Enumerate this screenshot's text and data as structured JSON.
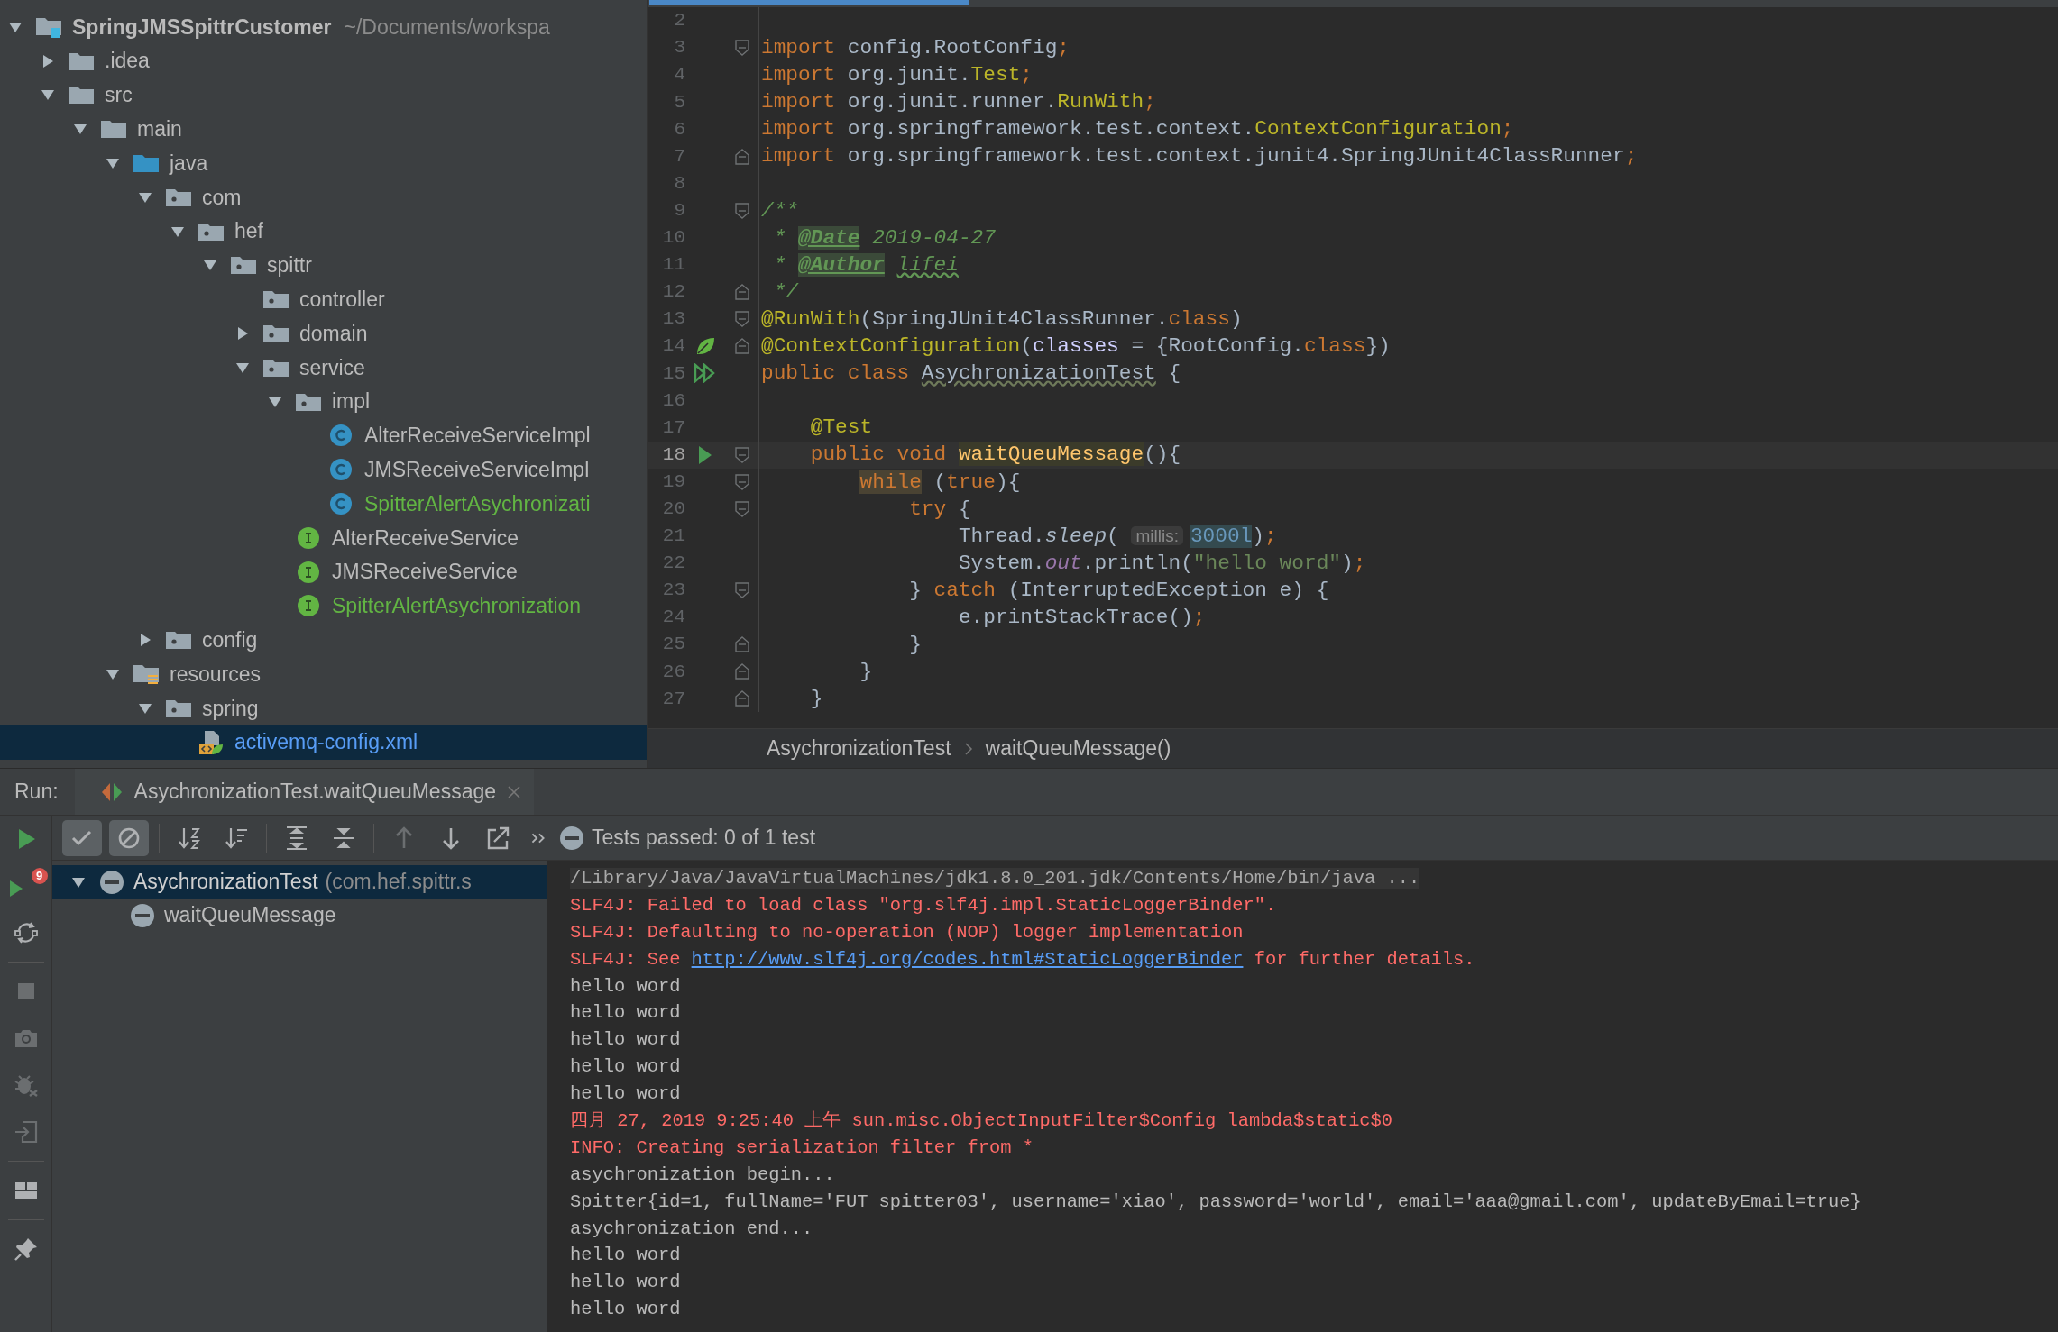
{
  "project_tree": [
    {
      "label": "SpringJMSSpittrCustomer",
      "path": "~/Documents/workspa",
      "kind": "module",
      "expanded": true,
      "selected": false,
      "color": "#bbbbbb",
      "children": [
        {
          "label": ".idea",
          "kind": "folder",
          "expanded": false,
          "selected": false,
          "color": "#bbbbbb"
        },
        {
          "label": "src",
          "kind": "folder",
          "expanded": true,
          "selected": false,
          "color": "#bbbbbb",
          "children": [
            {
              "label": "main",
              "kind": "folder",
              "expanded": true,
              "selected": false,
              "color": "#bbbbbb",
              "children": [
                {
                  "label": "java",
                  "kind": "source-folder",
                  "expanded": true,
                  "selected": false,
                  "color": "#bbbbbb",
                  "children": [
                    {
                      "label": "com",
                      "kind": "package",
                      "expanded": true,
                      "selected": false,
                      "color": "#bbbbbb",
                      "children": [
                        {
                          "label": "hef",
                          "kind": "package",
                          "expanded": true,
                          "selected": false,
                          "color": "#bbbbbb",
                          "children": [
                            {
                              "label": "spittr",
                              "kind": "package",
                              "expanded": true,
                              "selected": false,
                              "color": "#bbbbbb",
                              "children": [
                                {
                                  "label": "controller",
                                  "kind": "package",
                                  "selected": false,
                                  "color": "#bbbbbb"
                                },
                                {
                                  "label": "domain",
                                  "kind": "package",
                                  "expanded": false,
                                  "selected": false,
                                  "color": "#bbbbbb"
                                },
                                {
                                  "label": "service",
                                  "kind": "package",
                                  "expanded": true,
                                  "selected": false,
                                  "color": "#bbbbbb",
                                  "children": [
                                    {
                                      "label": "impl",
                                      "kind": "package",
                                      "expanded": true,
                                      "selected": false,
                                      "color": "#bbbbbb",
                                      "children": [
                                        {
                                          "label": "AlterReceiveServiceImpl",
                                          "kind": "class",
                                          "selected": false,
                                          "color": "#bbbbbb"
                                        },
                                        {
                                          "label": "JMSReceiveServiceImpl",
                                          "kind": "class",
                                          "selected": false,
                                          "color": "#bbbbbb"
                                        },
                                        {
                                          "label": "SpitterAlertAsychronizati",
                                          "kind": "class",
                                          "selected": false,
                                          "color": "#62b543"
                                        }
                                      ]
                                    },
                                    {
                                      "label": "AlterReceiveService",
                                      "kind": "interface",
                                      "selected": false,
                                      "color": "#bbbbbb"
                                    },
                                    {
                                      "label": "JMSReceiveService",
                                      "kind": "interface",
                                      "selected": false,
                                      "color": "#bbbbbb"
                                    },
                                    {
                                      "label": "SpitterAlertAsychronization",
                                      "kind": "interface",
                                      "selected": false,
                                      "color": "#62b543"
                                    }
                                  ]
                                }
                              ]
                            }
                          ]
                        }
                      ]
                    },
                    {
                      "label": "config",
                      "kind": "package",
                      "expanded": false,
                      "selected": false,
                      "color": "#bbbbbb"
                    }
                  ]
                },
                {
                  "label": "resources",
                  "kind": "resource-folder",
                  "expanded": true,
                  "selected": false,
                  "color": "#bbbbbb",
                  "children": [
                    {
                      "label": "spring",
                      "kind": "package",
                      "expanded": true,
                      "selected": false,
                      "color": "#bbbbbb",
                      "children": [
                        {
                          "label": "activemq-config.xml",
                          "kind": "xml",
                          "selected": true,
                          "color": "#589df6"
                        }
                      ]
                    }
                  ]
                }
              ]
            }
          ]
        }
      ]
    }
  ],
  "editor": {
    "lines": [
      {
        "number": "2",
        "kind": "code",
        "current": false
      },
      {
        "number": "3",
        "kind": "code",
        "current": false,
        "fold_start": true,
        "fold_end": false,
        "tokens": [
          {
            "text": "import",
            "kind": "keyword"
          },
          {
            "text": " config.RootConfig",
            "kind": "plain"
          },
          {
            "text": ";",
            "kind": "keyword"
          }
        ]
      },
      {
        "number": "4",
        "kind": "code",
        "current": false,
        "tokens": [
          {
            "text": "import",
            "kind": "keyword"
          },
          {
            "text": " org.junit.",
            "kind": "plain"
          },
          {
            "text": "Test",
            "kind": "annotation"
          },
          {
            "text": ";",
            "kind": "keyword"
          }
        ]
      },
      {
        "number": "5",
        "kind": "code",
        "current": false,
        "tokens": [
          {
            "text": "import",
            "kind": "keyword"
          },
          {
            "text": " org.junit.runner.",
            "kind": "plain"
          },
          {
            "text": "RunWith",
            "kind": "annotation"
          },
          {
            "text": ";",
            "kind": "keyword"
          }
        ]
      },
      {
        "number": "6",
        "kind": "code",
        "current": false,
        "tokens": [
          {
            "text": "import",
            "kind": "keyword"
          },
          {
            "text": " org.springframework.test.context.",
            "kind": "plain"
          },
          {
            "text": "ContextConfiguration",
            "kind": "annotation"
          },
          {
            "text": ";",
            "kind": "keyword"
          }
        ]
      },
      {
        "number": "7",
        "kind": "code",
        "current": false,
        "fold_start": false,
        "fold_end": true,
        "tokens": [
          {
            "text": "import",
            "kind": "keyword"
          },
          {
            "text": " org.springframework.test.context.junit4.SpringJUnit4ClassRunner",
            "kind": "plain"
          },
          {
            "text": ";",
            "kind": "keyword"
          }
        ]
      },
      {
        "number": "8",
        "kind": "code",
        "current": false
      },
      {
        "number": "9",
        "kind": "code",
        "current": false,
        "fold_start": true,
        "fold_end": false,
        "tokens": [
          {
            "text": "/**",
            "kind": "doc"
          }
        ]
      },
      {
        "number": "10",
        "kind": "code",
        "current": false,
        "tokens": [
          {
            "text": " * ",
            "kind": "doc"
          },
          {
            "text": "@Date",
            "kind": "doc-tag"
          },
          {
            "text": " 2019-04-27",
            "kind": "doc"
          }
        ]
      },
      {
        "number": "11",
        "kind": "code",
        "current": false,
        "tokens": [
          {
            "text": " * ",
            "kind": "doc"
          },
          {
            "text": "@Author",
            "kind": "doc-tag"
          },
          {
            "text": " lifei",
            "kind": "doc-typo"
          }
        ]
      },
      {
        "number": "12",
        "kind": "code",
        "current": false,
        "fold_start": false,
        "fold_end": true,
        "tokens": [
          {
            "text": " */",
            "kind": "doc"
          }
        ]
      },
      {
        "number": "13",
        "kind": "code",
        "current": false,
        "fold_start": true,
        "fold_end": false,
        "tokens": [
          {
            "text": "@RunWith",
            "kind": "annotation"
          },
          {
            "text": "(SpringJUnit4ClassRunner.",
            "kind": "plain"
          },
          {
            "text": "class",
            "kind": "keyword"
          },
          {
            "text": ")",
            "kind": "plain"
          }
        ]
      },
      {
        "number": "14",
        "kind": "spring-bean",
        "current": false,
        "fold_start": false,
        "fold_end": true,
        "tokens": [
          {
            "text": "@ContextConfiguration",
            "kind": "annotation"
          },
          {
            "text": "(",
            "kind": "plain"
          },
          {
            "text": "classes",
            "kind": "param"
          },
          {
            "text": " = {RootConfig.",
            "kind": "plain"
          },
          {
            "text": "class",
            "kind": "keyword"
          },
          {
            "text": "})",
            "kind": "plain"
          }
        ]
      },
      {
        "number": "15",
        "kind": "test-class",
        "current": false,
        "tokens": [
          {
            "text": "public class ",
            "kind": "keyword"
          },
          {
            "text": "AsychronizationTest",
            "kind": "typo"
          },
          {
            "text": " {",
            "kind": "plain"
          }
        ]
      },
      {
        "number": "16",
        "kind": "code",
        "current": false
      },
      {
        "number": "17",
        "kind": "code",
        "current": false,
        "tokens": [
          {
            "text": "    @Test",
            "kind": "annotation"
          }
        ]
      },
      {
        "number": "18",
        "kind": "test-method",
        "current": true,
        "fold_start": true,
        "fold_end": false,
        "tokens": [
          {
            "text": "    public void ",
            "kind": "keyword"
          },
          {
            "text": "waitQueuMessage",
            "kind": "method-marked"
          },
          {
            "text": "(){",
            "kind": "plain"
          }
        ]
      },
      {
        "number": "19",
        "kind": "code",
        "current": false,
        "fold_start": true,
        "fold_end": false,
        "tokens": [
          {
            "text": "        while",
            "kind": "keyword-marked"
          },
          {
            "text": " (",
            "kind": "plain"
          },
          {
            "text": "true",
            "kind": "keyword"
          },
          {
            "text": "){",
            "kind": "plain"
          }
        ]
      },
      {
        "number": "20",
        "kind": "code",
        "current": false,
        "fold_start": true,
        "fold_end": false,
        "tokens": [
          {
            "text": "            try",
            "kind": "keyword"
          },
          {
            "text": " {",
            "kind": "plain"
          }
        ]
      },
      {
        "number": "21",
        "kind": "code",
        "current": false,
        "tokens": [
          {
            "text": "                Thread.",
            "kind": "plain"
          },
          {
            "text": "sleep",
            "kind": "static-call"
          },
          {
            "text": "( ",
            "kind": "plain"
          },
          {
            "text": "millis:",
            "kind": "hint"
          },
          {
            "text": "3000l",
            "kind": "number-marked"
          },
          {
            "text": ")",
            "kind": "plain"
          },
          {
            "text": ";",
            "kind": "keyword"
          }
        ]
      },
      {
        "number": "22",
        "kind": "code",
        "current": false,
        "tokens": [
          {
            "text": "                System.",
            "kind": "plain"
          },
          {
            "text": "out",
            "kind": "field"
          },
          {
            "text": ".println(",
            "kind": "plain"
          },
          {
            "text": "\"hello word\"",
            "kind": "string"
          },
          {
            "text": ")",
            "kind": "plain"
          },
          {
            "text": ";",
            "kind": "keyword"
          }
        ]
      },
      {
        "number": "23",
        "kind": "code",
        "current": false,
        "fold_start": true,
        "fold_end": false,
        "tokens": [
          {
            "text": "            } ",
            "kind": "plain"
          },
          {
            "text": "catch",
            "kind": "keyword"
          },
          {
            "text": " (InterruptedException e) {",
            "kind": "plain"
          }
        ]
      },
      {
        "number": "24",
        "kind": "code",
        "current": false,
        "tokens": [
          {
            "text": "                e.printStackTrace()",
            "kind": "plain"
          },
          {
            "text": ";",
            "kind": "keyword"
          }
        ]
      },
      {
        "number": "25",
        "kind": "code",
        "current": false,
        "fold_start": false,
        "fold_end": true,
        "tokens": [
          {
            "text": "            }",
            "kind": "plain"
          }
        ]
      },
      {
        "number": "26",
        "kind": "code",
        "current": false,
        "fold_start": false,
        "fold_end": true,
        "tokens": [
          {
            "text": "        }",
            "kind": "plain"
          }
        ]
      },
      {
        "number": "27",
        "kind": "code",
        "current": false,
        "fold_start": false,
        "fold_end": true,
        "tokens": [
          {
            "text": "    }",
            "kind": "plain"
          }
        ]
      }
    ],
    "breadcrumbs": [
      "AsychronizationTest",
      "waitQueuMessage()"
    ]
  },
  "run_panel": {
    "label": "Run:",
    "tab": {
      "title": "AsychronizationTest.waitQueuMessage"
    },
    "side_tools": [
      {
        "kind": "run",
        "disabled": false
      },
      {
        "kind": "rerun-failed",
        "disabled": false,
        "badge": "9"
      },
      {
        "kind": "auto-test",
        "disabled": false
      },
      {
        "kind": "separator"
      },
      {
        "kind": "stop",
        "disabled": true
      },
      {
        "kind": "snapshot",
        "disabled": true
      },
      {
        "kind": "debug",
        "disabled": true
      },
      {
        "kind": "import",
        "disabled": true
      },
      {
        "kind": "separator"
      },
      {
        "kind": "layout",
        "disabled": false
      },
      {
        "kind": "separator"
      },
      {
        "kind": "pin",
        "disabled": false
      }
    ],
    "toolbar": [
      {
        "kind": "show-passed",
        "pressed": true,
        "disabled": false
      },
      {
        "kind": "show-ignored",
        "pressed": true,
        "disabled": false
      },
      {
        "kind": "separator"
      },
      {
        "kind": "sort-alpha",
        "pressed": false,
        "disabled": false
      },
      {
        "kind": "sort-duration",
        "pressed": false,
        "disabled": false
      },
      {
        "kind": "separator"
      },
      {
        "kind": "expand-all",
        "pressed": false,
        "disabled": false
      },
      {
        "kind": "collapse-all",
        "pressed": false,
        "disabled": false
      },
      {
        "kind": "separator"
      },
      {
        "kind": "previous",
        "pressed": false,
        "disabled": true
      },
      {
        "kind": "next",
        "pressed": false,
        "disabled": false
      },
      {
        "kind": "export",
        "pressed": false,
        "disabled": false
      },
      {
        "kind": "more",
        "pressed": false,
        "disabled": false
      }
    ],
    "status": "Tests passed: 0 of 1 test",
    "tests": [
      {
        "label": "AsychronizationTest",
        "detail": "(com.hef.spittr.s",
        "kind": "terminated",
        "expanded": true,
        "selected": true,
        "children": [
          {
            "label": "waitQueuMessage",
            "kind": "terminated",
            "selected": false
          }
        ]
      }
    ],
    "console": [
      {
        "segments": [
          {
            "text": "/Library/Java/JavaVirtualMachines/jdk1.8.0_201.jdk/Contents/Home/bin/java ...",
            "kind": "command"
          }
        ]
      },
      {
        "segments": [
          {
            "text": "SLF4J: Failed to load class \"org.slf4j.impl.StaticLoggerBinder\".",
            "kind": "error"
          }
        ]
      },
      {
        "segments": [
          {
            "text": "SLF4J: Defaulting to no-operation (NOP) logger implementation",
            "kind": "error"
          }
        ]
      },
      {
        "segments": [
          {
            "text": "SLF4J: See ",
            "kind": "error"
          },
          {
            "text": "http://www.slf4j.org/codes.html#StaticLoggerBinder",
            "kind": "link"
          },
          {
            "text": " for further details.",
            "kind": "error"
          }
        ]
      },
      {
        "segments": [
          {
            "text": "hello word",
            "kind": "output"
          }
        ]
      },
      {
        "segments": [
          {
            "text": "hello word",
            "kind": "output"
          }
        ]
      },
      {
        "segments": [
          {
            "text": "hello word",
            "kind": "output"
          }
        ]
      },
      {
        "segments": [
          {
            "text": "hello word",
            "kind": "output"
          }
        ]
      },
      {
        "segments": [
          {
            "text": "hello word",
            "kind": "output"
          }
        ]
      },
      {
        "segments": [
          {
            "text": "四月 27, 2019 9:25:40 上午 sun.misc.ObjectInputFilter$Config lambda$static$0",
            "kind": "error"
          }
        ]
      },
      {
        "segments": [
          {
            "text": "INFO: Creating serialization filter from *",
            "kind": "error"
          }
        ]
      },
      {
        "segments": [
          {
            "text": "asychronization begin...",
            "kind": "output"
          }
        ]
      },
      {
        "segments": [
          {
            "text": "Spitter{id=1, fullName='FUT spitter03', username='xiao', password='world', email='aaa@gmail.com', updateByEmail=true}",
            "kind": "output"
          }
        ]
      },
      {
        "segments": [
          {
            "text": "asychronization end...",
            "kind": "output"
          }
        ]
      },
      {
        "segments": [
          {
            "text": "hello word",
            "kind": "output"
          }
        ]
      },
      {
        "segments": [
          {
            "text": "hello word",
            "kind": "output"
          }
        ]
      },
      {
        "segments": [
          {
            "text": "hello word",
            "kind": "output"
          }
        ]
      }
    ]
  }
}
